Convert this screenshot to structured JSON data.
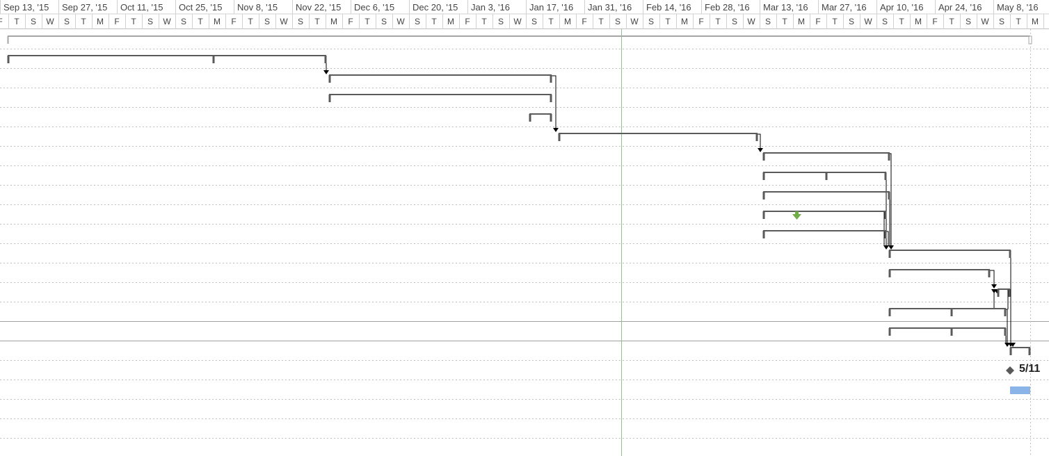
{
  "timescale": {
    "weeks": [
      "Sep 13, '15",
      "Sep 27, '15",
      "Oct 11, '15",
      "Oct 25, '15",
      "Nov 8, '15",
      "Nov 22, '15",
      "Dec 6, '15",
      "Dec 20, '15",
      "Jan 3, '16",
      "Jan 17, '16",
      "Jan 31, '16",
      "Feb 14, '16",
      "Feb 28, '16",
      "Mar 13, '16",
      "Mar 27, '16",
      "Apr 10, '16",
      "Apr 24, '16",
      "May 8, '16"
    ],
    "day_letters": [
      "F",
      "T",
      "S",
      "W",
      "S",
      "T",
      "M",
      "F",
      "T",
      "S",
      "W",
      "S",
      "T",
      "M",
      "F",
      "T",
      "S",
      "W",
      "S",
      "T",
      "M",
      "F",
      "T",
      "S",
      "W",
      "S",
      "T",
      "M",
      "F",
      "T",
      "S",
      "W",
      "S",
      "T",
      "M",
      "F",
      "T",
      "S",
      "W",
      "S",
      "T",
      "M",
      "F",
      "T",
      "S",
      "W",
      "S",
      "T",
      "M",
      "F",
      "T",
      "S",
      "W",
      "S",
      "T",
      "M",
      "F",
      "T",
      "S",
      "W",
      "S",
      "T",
      "M"
    ]
  },
  "milestone": {
    "label": "5/11"
  },
  "colors": {
    "bar": "#5a5a5a",
    "summary": "#a6a6a6",
    "link": "#000000",
    "today_line": "#8fc28f",
    "gridline": "#bfbfbf",
    "separator": "#a0a0a0",
    "indicator": "#70ad47",
    "progress": "#8ab4e8"
  }
}
